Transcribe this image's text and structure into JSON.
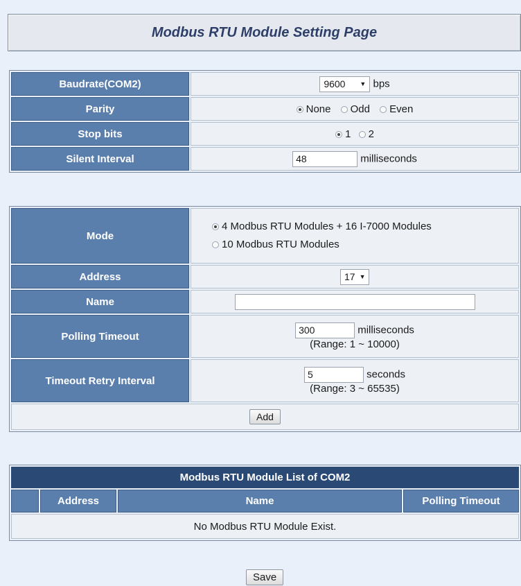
{
  "page_title": "Modbus RTU Module Setting Page",
  "serial": {
    "baudrate_label": "Baudrate(COM2)",
    "baudrate_value": "9600",
    "baudrate_unit": "bps",
    "parity_label": "Parity",
    "parity_options": [
      "None",
      "Odd",
      "Even"
    ],
    "parity_selected": "None",
    "stopbits_label": "Stop bits",
    "stopbits_options": [
      "1",
      "2"
    ],
    "stopbits_selected": "1",
    "silent_label": "Silent Interval",
    "silent_value": "48",
    "silent_unit": "milliseconds"
  },
  "module": {
    "mode_label": "Mode",
    "mode_options": [
      "4 Modbus RTU Modules + 16 I-7000 Modules",
      "10 Modbus RTU Modules"
    ],
    "mode_selected": "4 Modbus RTU Modules + 16 I-7000 Modules",
    "address_label": "Address",
    "address_value": "17",
    "name_label": "Name",
    "name_value": "",
    "polling_label": "Polling Timeout",
    "polling_value": "300",
    "polling_unit": "milliseconds",
    "polling_range": "(Range: 1 ~ 10000)",
    "retry_label": "Timeout Retry Interval",
    "retry_value": "5",
    "retry_unit": "seconds",
    "retry_range": "(Range: 3 ~ 65535)",
    "add_label": "Add"
  },
  "list": {
    "title": "Modbus RTU Module List of COM2",
    "columns": [
      "",
      "Address",
      "Name",
      "Polling Timeout"
    ],
    "empty_text": "No Modbus RTU Module Exist."
  },
  "save_label": "Save"
}
